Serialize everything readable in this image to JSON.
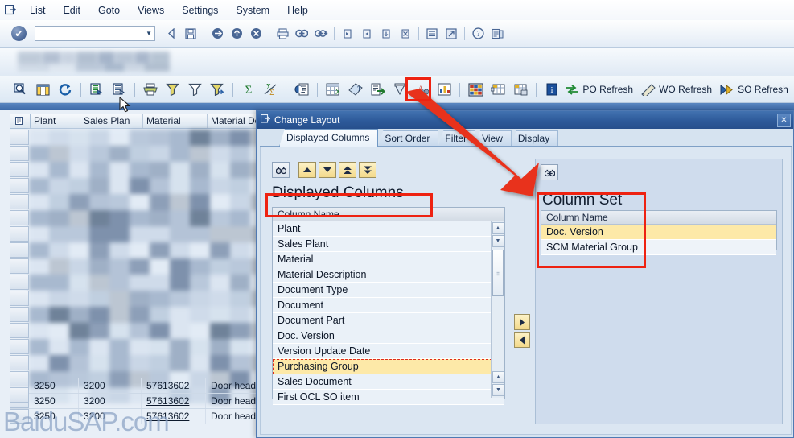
{
  "menu": {
    "system_icon": "sap-window-icon",
    "items": [
      "List",
      "Edit",
      "Goto",
      "Views",
      "Settings",
      "System",
      "Help"
    ]
  },
  "toolbar": {
    "ok_button": "enter-check-icon",
    "command_field_value": "",
    "command_field_placeholder": "",
    "icons": [
      "back-arrow-icon",
      "save-icon",
      "exit-icon",
      "up-one-level-icon",
      "cancel-icon",
      "print-icon",
      "find-icon",
      "find-next-icon",
      "first-page-icon",
      "previous-page-icon",
      "next-page-icon",
      "last-page-icon",
      "new-session-icon",
      "create-shortcut-icon",
      "help-icon",
      "customize-local-layout-icon"
    ]
  },
  "alv_toolbar": {
    "icons": [
      "detail-magnifier-icon",
      "columns-icon",
      "refresh-icon",
      "set-filter-list-icon",
      "display-list-icon",
      "print-icon",
      "filter-icon",
      "filter-off-icon",
      "filter-settings-icon",
      "total-sum-icon",
      "subtotal-icon",
      "print-preview-icon",
      "spreadsheet-icon",
      "word-processing-icon",
      "export-icon",
      "mail-recipient-icon",
      "abc-analysis-icon",
      "graphic-icon",
      "select-layout-icon",
      "change-layout-icon",
      "save-layout-icon",
      "info-icon"
    ],
    "highlighted_icon": "change-layout-icon",
    "buttons": [
      {
        "icon": "po-refresh-icon",
        "label": "PO Refresh"
      },
      {
        "icon": "wo-refresh-icon",
        "label": "WO Refresh"
      },
      {
        "icon": "so-refresh-icon",
        "label": "SO Refresh"
      }
    ]
  },
  "grid": {
    "headers": [
      "Plant",
      "Sales Plan",
      "Material",
      "Material Descrip"
    ],
    "rows": [
      {
        "plant": "3250",
        "sales_plant": "3200",
        "material": "57613602",
        "description": "Door head pane"
      },
      {
        "plant": "3250",
        "sales_plant": "3200",
        "material": "57613602",
        "description": "Door head pane"
      },
      {
        "plant": "3250",
        "sales_plant": "3200",
        "material": "57613602",
        "description": "Door head pane"
      }
    ],
    "watermark": "BaiduSAP.com"
  },
  "dialog": {
    "title": "Change Layout",
    "title_icon": "sap-window-icon",
    "close_icon": "close-icon",
    "tabs": [
      {
        "label": "Displayed Columns",
        "active": true
      },
      {
        "label": "Sort Order",
        "active": false
      },
      {
        "label": "Filter",
        "active": false
      },
      {
        "label": "View",
        "active": false
      },
      {
        "label": "Display",
        "active": false
      }
    ],
    "left": {
      "annotation_label": "Displayed Columns",
      "toolbar_icons": [
        "find-binoculars-icon",
        "move-up-icon",
        "move-down-icon",
        "move-to-top-icon",
        "move-to-bottom-icon"
      ],
      "column_header": "Column Name",
      "items": [
        {
          "label": "Plant",
          "selected": false
        },
        {
          "label": "Sales Plant",
          "selected": false
        },
        {
          "label": "Material",
          "selected": false
        },
        {
          "label": "Material Description",
          "selected": false
        },
        {
          "label": "Document Type",
          "selected": false
        },
        {
          "label": "Document",
          "selected": false
        },
        {
          "label": "Document Part",
          "selected": false
        },
        {
          "label": "Doc. Version",
          "selected": false
        },
        {
          "label": "Version Update Date",
          "selected": false
        },
        {
          "label": "Purchasing Group",
          "selected": true
        },
        {
          "label": "Sales Document",
          "selected": false
        },
        {
          "label": "First OCL SO  item",
          "selected": false
        }
      ]
    },
    "transfer": {
      "to_right_icon": "arrow-right-icon",
      "to_left_icon": "arrow-left-icon"
    },
    "right": {
      "annotation_label": "Column Set",
      "toolbar_icons": [
        "find-binoculars-icon"
      ],
      "column_header": "Column Name",
      "items": [
        {
          "label": "Doc. Version",
          "selected": true
        },
        {
          "label": "SCM Material Group",
          "selected": false
        }
      ]
    }
  },
  "annotations": {
    "arrow_color": "#e8321c",
    "box_color": "#ee2211",
    "highlight_color": "#fde9a8"
  }
}
